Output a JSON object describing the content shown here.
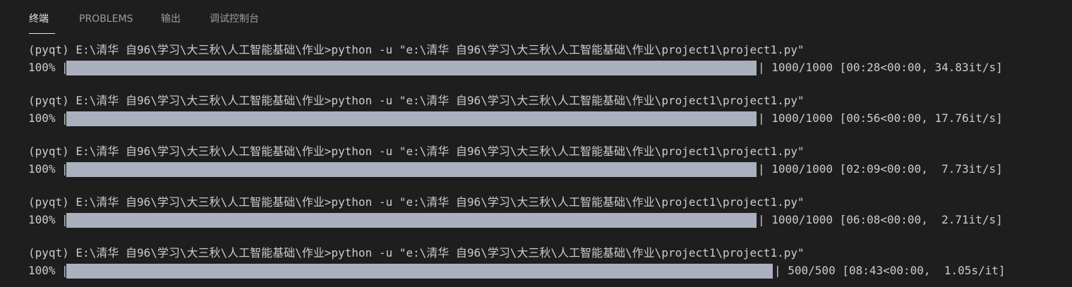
{
  "tabs": [
    {
      "label": "终端",
      "active": true
    },
    {
      "label": "PROBLEMS",
      "active": false
    },
    {
      "label": "输出",
      "active": false
    },
    {
      "label": "调试控制台",
      "active": false
    }
  ],
  "runs": [
    {
      "command": "(pyqt) E:\\清华 自96\\学习\\大三秋\\人工智能基础\\作业>python -u \"e:\\清华 自96\\学习\\大三秋\\人工智能基础\\作业\\project1\\project1.py\"",
      "percent": "100%",
      "bar_open": "|",
      "stats": "| 1000/1000 [00:28<00:00, 34.83it/s]",
      "progress": 1.0
    },
    {
      "command": "(pyqt) E:\\清华 自96\\学习\\大三秋\\人工智能基础\\作业>python -u \"e:\\清华 自96\\学习\\大三秋\\人工智能基础\\作业\\project1\\project1.py\"",
      "percent": "100%",
      "bar_open": "|",
      "stats": "| 1000/1000 [00:56<00:00, 17.76it/s]",
      "progress": 1.0
    },
    {
      "command": "(pyqt) E:\\清华 自96\\学习\\大三秋\\人工智能基础\\作业>python -u \"e:\\清华 自96\\学习\\大三秋\\人工智能基础\\作业\\project1\\project1.py\"",
      "percent": "100%",
      "bar_open": "|",
      "stats": "| 1000/1000 [02:09<00:00,  7.73it/s]",
      "progress": 1.0
    },
    {
      "command": "(pyqt) E:\\清华 自96\\学习\\大三秋\\人工智能基础\\作业>python -u \"e:\\清华 自96\\学习\\大三秋\\人工智能基础\\作业\\project1\\project1.py\"",
      "percent": "100%",
      "bar_open": "|",
      "stats": "| 1000/1000 [06:08<00:00,  2.71it/s]",
      "progress": 1.0
    },
    {
      "command": "(pyqt) E:\\清华 自96\\学习\\大三秋\\人工智能基础\\作业>python -u \"e:\\清华 自96\\学习\\大三秋\\人工智能基础\\作业\\project1\\project1.py\"",
      "percent": "100%",
      "bar_open": "|",
      "stats": "| 500/500 [08:43<00:00,  1.05s/it]",
      "progress": 1.0
    }
  ],
  "colors": {
    "background": "#1e1e1e",
    "text": "#cccccc",
    "tab_active": "#e7e7e7",
    "tab_inactive": "#9d9d9d",
    "progress_fill": "#aab0bd"
  }
}
